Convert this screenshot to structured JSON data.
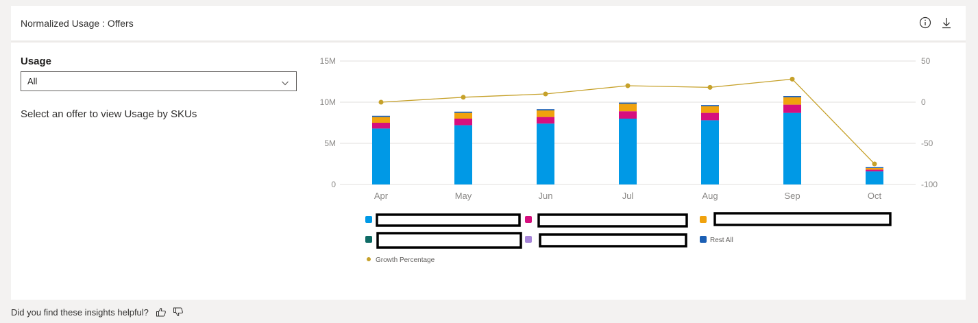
{
  "card": {
    "title": "Normalized Usage : Offers"
  },
  "header_icons": [
    "info-icon",
    "download-icon"
  ],
  "filter": {
    "label": "Usage",
    "selected": "All"
  },
  "hint_text": "Select an offer to view Usage by SKUs",
  "footer": {
    "question": "Did you find these insights helpful?"
  },
  "colors": {
    "s1": "#0099e6",
    "s2": "#d60f7e",
    "s3": "#f0a20d",
    "s4": "#0f6b65",
    "s5": "#a685d8",
    "s6": "#1b5fb4",
    "growth": "#c6a12a",
    "redaction": "#000000"
  },
  "chart_data": {
    "type": "bar",
    "stacked": true,
    "categories": [
      "Apr",
      "May",
      "Jun",
      "Jul",
      "Aug",
      "Sep",
      "Oct"
    ],
    "y_left_ticks": [
      "15M",
      "10M",
      "5M",
      "0"
    ],
    "y_right_ticks": [
      "50",
      "0",
      "-50",
      "-100"
    ],
    "ylim_left": [
      0,
      15000000
    ],
    "ylim_right": [
      -100,
      50
    ],
    "grid": true,
    "series": [
      {
        "values": [
          6800000,
          7200000,
          7400000,
          8000000,
          7800000,
          8700000,
          1600000
        ],
        "color_key": "s1",
        "redacted": true
      },
      {
        "values": [
          700000,
          800000,
          800000,
          900000,
          900000,
          1000000,
          200000
        ],
        "color_key": "s2",
        "redacted": true
      },
      {
        "values": [
          700000,
          700000,
          800000,
          900000,
          800000,
          900000,
          200000
        ],
        "color_key": "s3",
        "redacted": true
      },
      {
        "values": [
          0,
          0,
          0,
          0,
          0,
          0,
          0
        ],
        "color_key": "s4",
        "redacted": true
      },
      {
        "values": [
          0,
          0,
          0,
          0,
          0,
          0,
          0
        ],
        "color_key": "s5",
        "redacted": true
      },
      {
        "name": "Rest All",
        "values": [
          150000,
          150000,
          150000,
          150000,
          150000,
          150000,
          100000
        ],
        "color_key": "s6"
      }
    ],
    "line_series": {
      "name": "Growth Percentage",
      "axis": "right",
      "values": [
        0,
        6,
        10,
        20,
        18,
        28,
        -75
      ],
      "color_key": "growth"
    },
    "legend": {
      "placement": "bottom",
      "rest_all_label": "Rest All",
      "growth_label": "Growth Percentage"
    }
  }
}
